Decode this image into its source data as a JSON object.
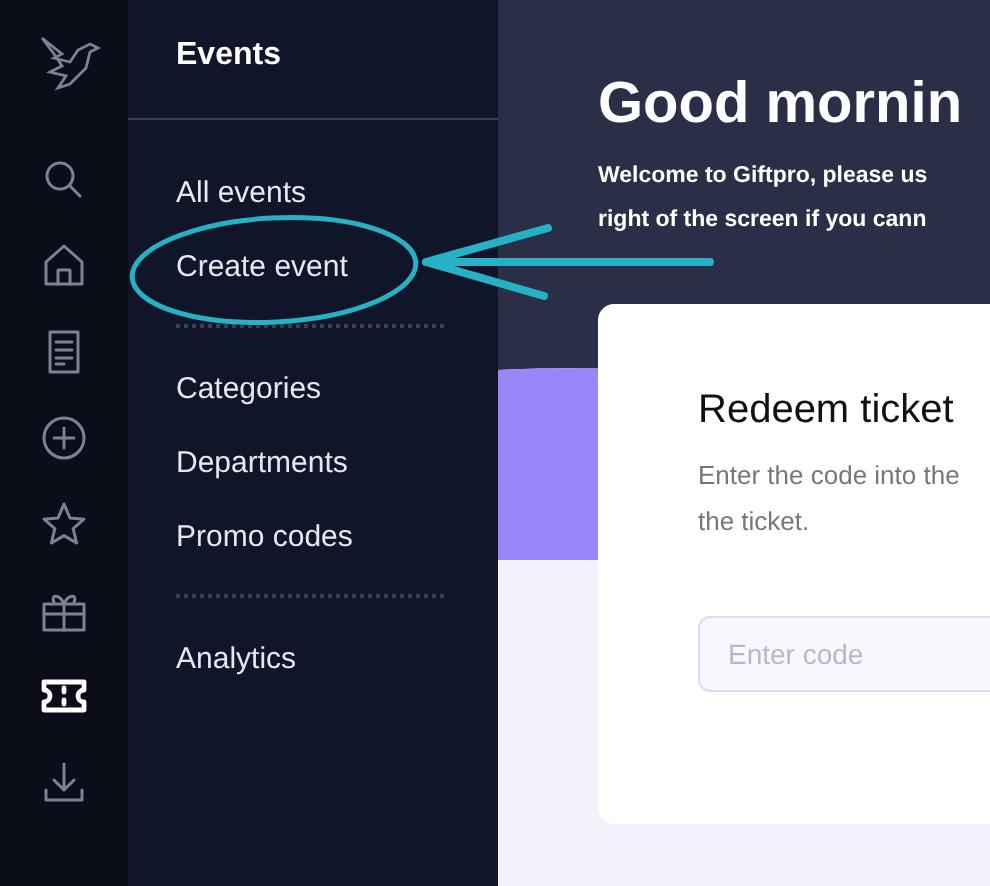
{
  "rail": [
    {
      "kind": "search",
      "selected": false
    },
    {
      "kind": "home",
      "selected": false
    },
    {
      "kind": "document",
      "selected": false
    },
    {
      "kind": "add",
      "selected": false
    },
    {
      "kind": "star",
      "selected": false
    },
    {
      "kind": "gift",
      "selected": false
    },
    {
      "kind": "ticket",
      "selected": true
    },
    {
      "kind": "download",
      "selected": false
    }
  ],
  "submenu": {
    "title": "Events",
    "groups": [
      [
        "All events",
        "Create event"
      ],
      [
        "Categories",
        "Departments",
        "Promo codes"
      ],
      [
        "Analytics"
      ]
    ]
  },
  "hero": {
    "heading": "Good mornin",
    "lines": [
      "Welcome to Giftpro, please us",
      "right of the screen if you cann"
    ]
  },
  "card": {
    "title": "Redeem ticket",
    "description_lines": [
      "Enter the code into the",
      "the ticket."
    ],
    "input": {
      "placeholder": "Enter code"
    }
  }
}
